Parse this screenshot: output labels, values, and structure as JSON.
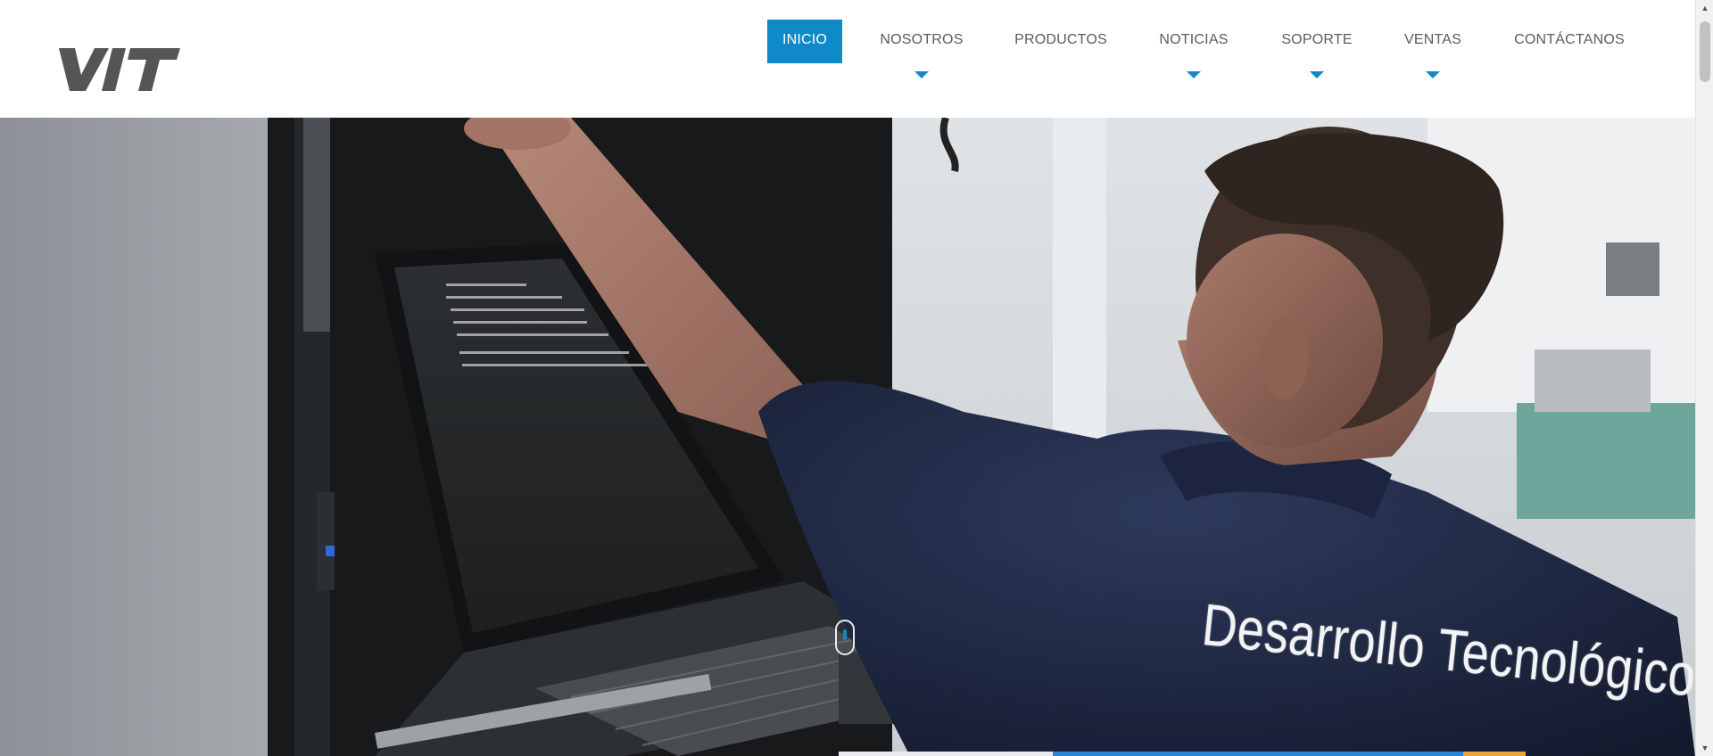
{
  "brand": {
    "logo_text": "VIT",
    "color": "#555555"
  },
  "nav": {
    "accent": "#0e8ac8",
    "items": [
      {
        "label": "INICIO",
        "active": true,
        "has_dropdown": false
      },
      {
        "label": "NOSOTROS",
        "active": false,
        "has_dropdown": true
      },
      {
        "label": "PRODUCTOS",
        "active": false,
        "has_dropdown": false
      },
      {
        "label": "NOTICIAS",
        "active": false,
        "has_dropdown": true
      },
      {
        "label": "SOPORTE",
        "active": false,
        "has_dropdown": true
      },
      {
        "label": "VENTAS",
        "active": false,
        "has_dropdown": true
      },
      {
        "label": "CONTÁCTANOS",
        "active": false,
        "has_dropdown": false
      }
    ]
  },
  "hero": {
    "image_description": "Technician in navy shirt working at a server rack with a rack-mounted laptop console",
    "shirt_text": "Desarrollo Tecnológico",
    "scroll_indicator_icon": "mouse-scroll-icon"
  },
  "scrollbar": {
    "up_icon": "chevron-up-icon",
    "down_icon": "chevron-down-icon"
  }
}
